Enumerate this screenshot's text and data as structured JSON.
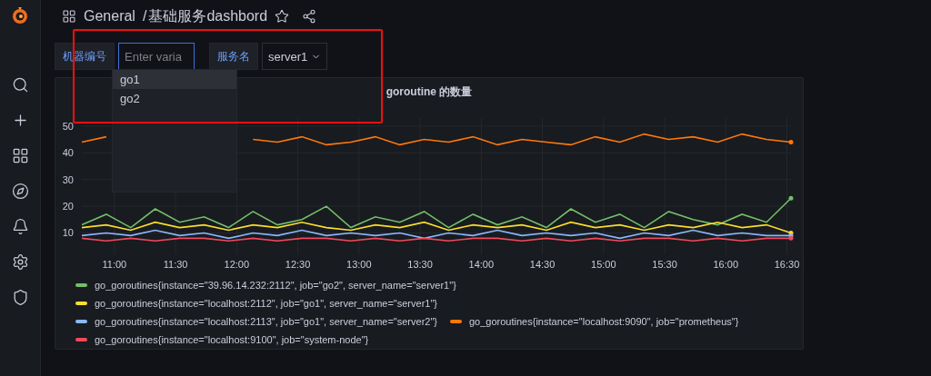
{
  "breadcrumb": {
    "folder": "General",
    "separator": "/",
    "title": "基础服务dashbord"
  },
  "variables": [
    {
      "label": "机器编号",
      "kind": "input",
      "placeholder": "Enter varia"
    },
    {
      "label": "服务名",
      "kind": "select",
      "value": "server1"
    }
  ],
  "dropdown": [
    {
      "label": "go1",
      "selected": true
    },
    {
      "label": "go2",
      "selected": false
    }
  ],
  "panel": {
    "title": "goroutine 的数量",
    "chart_data": {
      "type": "line",
      "x": [
        644,
        656,
        668,
        680,
        692,
        704,
        716,
        728,
        740,
        752,
        764,
        776,
        788,
        800,
        812,
        824,
        836,
        848,
        860,
        872,
        884,
        896,
        908,
        920,
        932,
        944,
        956,
        968,
        980,
        992
      ],
      "xticks": [
        {
          "value": 660,
          "label": "11:00"
        },
        {
          "value": 690,
          "label": "11:30"
        },
        {
          "value": 720,
          "label": "12:00"
        },
        {
          "value": 750,
          "label": "12:30"
        },
        {
          "value": 780,
          "label": "13:00"
        },
        {
          "value": 810,
          "label": "13:30"
        },
        {
          "value": 840,
          "label": "14:00"
        },
        {
          "value": 870,
          "label": "14:30"
        },
        {
          "value": 900,
          "label": "15:00"
        },
        {
          "value": 930,
          "label": "15:30"
        },
        {
          "value": 960,
          "label": "16:00"
        },
        {
          "value": 990,
          "label": "16:30"
        }
      ],
      "yticks": [
        10,
        20,
        30,
        40,
        50
      ],
      "xlim": [
        644,
        992
      ],
      "ylim": [
        2,
        53
      ],
      "grid": true,
      "series": [
        {
          "name": "go_goroutines{instance=\"39.96.14.232:2112\", job=\"go2\", server_name=\"server1\"}",
          "color": "#73bf69",
          "values": [
            13,
            17,
            12,
            19,
            14,
            16,
            12,
            18,
            13,
            15,
            20,
            12,
            16,
            14,
            18,
            12,
            17,
            13,
            16,
            12,
            19,
            14,
            17,
            12,
            18,
            15,
            13,
            17,
            14,
            23
          ]
        },
        {
          "name": "go_goroutines{instance=\"localhost:2112\", job=\"go1\", server_name=\"server1\"}",
          "color": "#fade2a",
          "values": [
            12,
            13,
            11,
            14,
            12,
            13,
            11,
            13,
            12,
            14,
            12,
            11,
            13,
            12,
            14,
            11,
            13,
            12,
            13,
            11,
            14,
            12,
            13,
            11,
            13,
            12,
            14,
            12,
            13,
            10
          ]
        },
        {
          "name": "go_goroutines{instance=\"localhost:2113\", job=\"go1\", server_name=\"server2\"}",
          "color": "#8ab8ff",
          "values": [
            9,
            10,
            9,
            11,
            9,
            10,
            8,
            10,
            9,
            11,
            9,
            10,
            9,
            10,
            8,
            10,
            9,
            11,
            9,
            10,
            9,
            10,
            8,
            10,
            9,
            11,
            9,
            10,
            9,
            9
          ]
        },
        {
          "name": "go_goroutines{instance=\"localhost:9090\", job=\"prometheus\"}",
          "color": "#ff780a",
          "values": [
            44,
            46,
            null,
            null,
            null,
            null,
            null,
            45,
            44,
            46,
            43,
            44,
            46,
            43,
            45,
            44,
            46,
            43,
            45,
            44,
            43,
            46,
            44,
            47,
            45,
            46,
            44,
            47,
            45,
            44
          ]
        },
        {
          "name": "go_goroutines{instance=\"localhost:9100\", job=\"system-node\"}",
          "color": "#f2495c",
          "values": [
            8,
            7,
            8,
            7,
            8,
            8,
            7,
            8,
            7,
            8,
            8,
            7,
            8,
            7,
            8,
            7,
            8,
            8,
            7,
            8,
            7,
            8,
            7,
            8,
            8,
            7,
            8,
            7,
            8,
            8
          ]
        }
      ]
    }
  }
}
